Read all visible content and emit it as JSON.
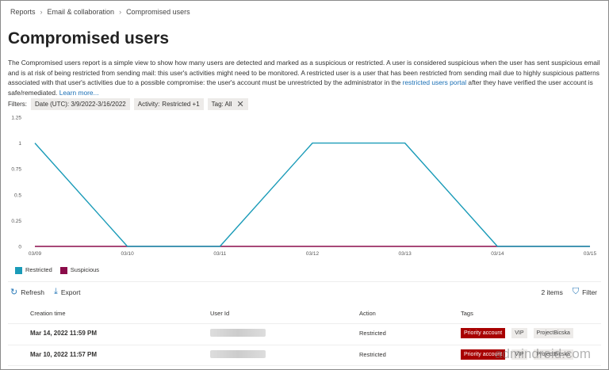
{
  "breadcrumb": [
    "Reports",
    "Email & collaboration",
    "Compromised users"
  ],
  "page_title": "Compromised users",
  "description": {
    "text1": "The Compromised users report is a simple view to show how many users are detected and marked as a suspicious or restricted. A user is considered suspicious when the user has sent suspicious email and is at risk of being restricted from sending mail: this user's activities might need to be monitored. A restricted user is a user that has been restricted from sending mail due to highly suspicious patterns associated with that user's activities due to a possible compromise: the user's account must be unrestricted by the administrator in the ",
    "link1": "restricted users portal",
    "text2": " after they have verified the user account is safe/remediated. ",
    "link2": "Learn more..."
  },
  "filters": {
    "label": "Filters:",
    "date": "Date (UTC): 3/9/2022-3/16/2022",
    "activity_key": "Activity: ",
    "activity_val": "Restricted +1",
    "tag": "Tag: All"
  },
  "chart_data": {
    "type": "line",
    "categories": [
      "03/09",
      "03/10",
      "03/11",
      "03/12",
      "03/13",
      "03/14",
      "03/15"
    ],
    "yticks": [
      "0",
      "0.25",
      "0.5",
      "0.75",
      "1",
      "1.25"
    ],
    "ylim": [
      0,
      1.25
    ],
    "series": [
      {
        "name": "Restricted",
        "color": "#1a9bb8",
        "values": [
          1,
          0,
          0,
          1,
          1,
          0,
          0
        ]
      },
      {
        "name": "Suspicious",
        "color": "#8b0c4a",
        "values": [
          0,
          0,
          0,
          0,
          0,
          0,
          0
        ]
      }
    ],
    "legend": "bottom-left"
  },
  "toolbar": {
    "refresh": "Refresh",
    "export": "Export",
    "count": "2 items",
    "filter": "Filter"
  },
  "table": {
    "headers": [
      "Creation time",
      "User Id",
      "Action",
      "Tags"
    ],
    "rows": [
      {
        "time": "Mar 14, 2022 11:59 PM",
        "action": "Restricted",
        "tags": [
          "Priority account",
          "VIP",
          "ProjectBicska"
        ]
      },
      {
        "time": "Mar 10, 2022 11:57 PM",
        "action": "Restricted",
        "tags": [
          "Priority account",
          "VIP",
          "ProjectBicska"
        ]
      }
    ]
  },
  "watermark": "admindroid.com"
}
